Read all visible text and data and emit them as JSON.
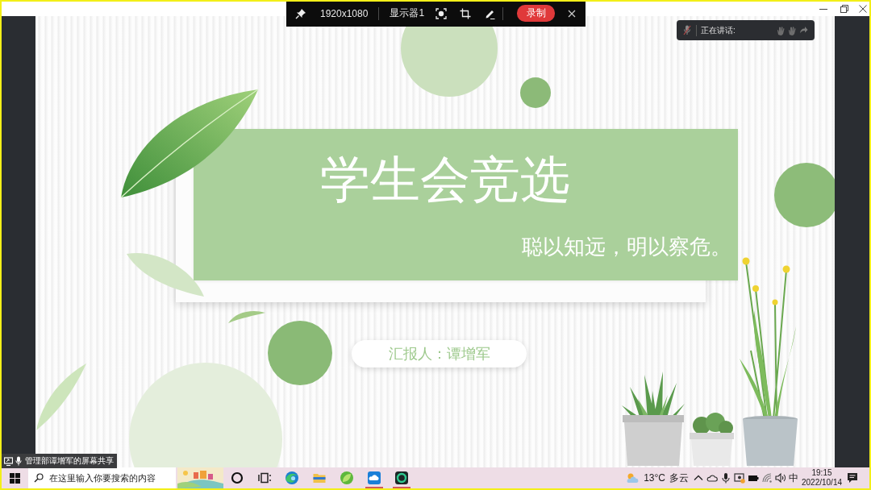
{
  "share_toolbar": {
    "resolution": "1920x1080",
    "display": "显示器1",
    "record_button": "录制"
  },
  "speaking_panel": {
    "label": "正在讲话:"
  },
  "slide": {
    "title": "学生会竞选",
    "subtitle": "聪以知远，明以察危。",
    "presenter": "汇报人：谭增军"
  },
  "share_tag": {
    "label": "管理部谭增军的屏幕共享"
  },
  "taskbar": {
    "search": {
      "placeholder": "在这里输入你要搜索的内容"
    },
    "apps": [
      {
        "kind": "cortana",
        "running": false
      },
      {
        "kind": "task-view",
        "running": false
      },
      {
        "kind": "edge",
        "running": false
      },
      {
        "kind": "folder",
        "running": false
      },
      {
        "kind": "leaf",
        "running": false
      },
      {
        "kind": "cloud",
        "running": true
      },
      {
        "kind": "ring",
        "running": true
      }
    ],
    "weather": {
      "temperature": "13°C",
      "condition": "多云"
    },
    "input_method": "中",
    "clock": {
      "time": "19:15",
      "date": "2022/10/14"
    }
  }
}
